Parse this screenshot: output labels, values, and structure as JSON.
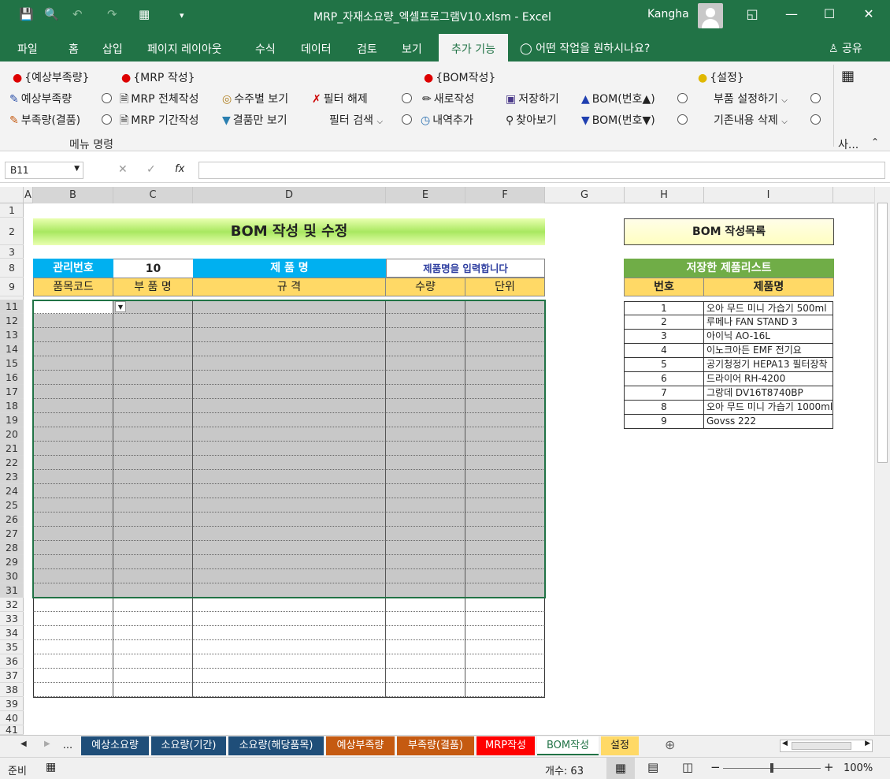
{
  "window": {
    "title": "MRP_자재소요량_엑셀프로그램V10.xlsm  -  Excel",
    "user": "Kangha"
  },
  "ribbon_tabs": [
    "파일",
    "홈",
    "삽입",
    "페이지 레이아웃",
    "수식",
    "데이터",
    "검토",
    "보기",
    "추가 기능"
  ],
  "active_tab": "추가 기능",
  "tell_me": "어떤 작업을 원하시나요?",
  "share": "공유",
  "ribbon": {
    "headers": [
      "{예상부족량}",
      "{MRP 작성}",
      "{BOM작성}",
      "{설정}"
    ],
    "btn_shortage_forecast": "예상부족량",
    "btn_shortage_defect": "부족량(결품)",
    "btn_mrp_all": "MRP 전체작성",
    "btn_mrp_period": "MRP 기간작성",
    "btn_by_order": "수주별 보기",
    "btn_defect_only": "결품만 보기",
    "btn_filter_clear": "필터 해제",
    "btn_filter_search": "필터 검색",
    "btn_new": "새로작성",
    "btn_add_history": "내역추가",
    "btn_save": "저장하기",
    "btn_find": "찾아보기",
    "btn_bom_up": "BOM(번호▲)",
    "btn_bom_down": "BOM(번호▼)",
    "btn_part_settings": "부품 설정하기",
    "btn_delete_existing": "기존내용 삭제",
    "group_label": "메뉴 명령",
    "collapsed_label": "사..."
  },
  "formula_bar": {
    "name_box": "B11",
    "fx": "fx",
    "value": ""
  },
  "columns": [
    "A",
    "B",
    "C",
    "D",
    "E",
    "F",
    "G",
    "H",
    "I"
  ],
  "rows": [
    "1",
    "2",
    "3",
    "8",
    "9",
    "11",
    "12",
    "13",
    "14",
    "15",
    "16",
    "17",
    "18",
    "19",
    "20",
    "21",
    "22",
    "23",
    "24",
    "25",
    "26",
    "27",
    "28",
    "29",
    "30",
    "31",
    "32",
    "33",
    "34",
    "35",
    "36",
    "37",
    "38",
    "39",
    "40",
    "41"
  ],
  "sheet": {
    "title": "BOM 작성 및 수정",
    "mgmt_label": "관리번호",
    "mgmt_value": "10",
    "product_label": "제 품 명",
    "product_value": "제품명을 입력합니다",
    "col_code": "품목코드",
    "col_part": "부 품 명",
    "col_spec": "규  격",
    "col_qty": "수량",
    "col_unit": "단위",
    "bom_list_button": "BOM 작성목록",
    "saved_list_title": "저장한 제품리스트",
    "saved_col_no": "번호",
    "saved_col_name": "제품명",
    "saved_items": [
      {
        "no": "1",
        "name": "오아 무드 미니 가습기 500ml"
      },
      {
        "no": "2",
        "name": "루메나 FAN STAND 3"
      },
      {
        "no": "3",
        "name": "아이닉 AO-16L"
      },
      {
        "no": "4",
        "name": "이노크아든 EMF 전기요"
      },
      {
        "no": "5",
        "name": "공기청정기 HEPA13 필터장착"
      },
      {
        "no": "6",
        "name": "드라이어 RH-4200"
      },
      {
        "no": "7",
        "name": "그랑데 DV16T8740BP"
      },
      {
        "no": "8",
        "name": "오아 무드 미니 가습기 1000ml"
      },
      {
        "no": "9",
        "name": "Govss 222"
      }
    ]
  },
  "sheet_tabs": [
    {
      "label": "...",
      "color": "#f0f0f0"
    },
    {
      "label": "예상소요량",
      "color": "#1f4e79"
    },
    {
      "label": "소요량(기간)",
      "color": "#1f4e79"
    },
    {
      "label": "소요량(해당품목)",
      "color": "#1f4e79"
    },
    {
      "label": "예상부족량",
      "color": "#c55a11"
    },
    {
      "label": "부족량(결품)",
      "color": "#c55a11"
    },
    {
      "label": "MRP작성",
      "color": "#ff0000"
    },
    {
      "label": "BOM작성",
      "color": "#ffffff"
    },
    {
      "label": "설정",
      "color": "#ffd966"
    }
  ],
  "status": {
    "ready": "준비",
    "count_label": "개수: 63",
    "zoom": "100%"
  }
}
